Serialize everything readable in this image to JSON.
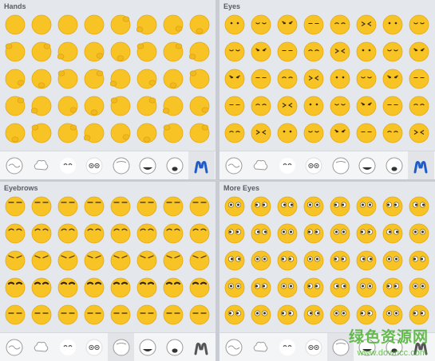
{
  "panels": [
    {
      "title": "Hands",
      "kind": "hands",
      "selected_tab": 7
    },
    {
      "title": "Eyes",
      "kind": "eyes",
      "selected_tab": 7
    },
    {
      "title": "Eyebrows",
      "kind": "brows",
      "selected_tab": 4
    },
    {
      "title": "More Eyes",
      "kind": "more",
      "selected_tab": 4
    }
  ],
  "tabs": [
    "outline-tab",
    "cloud-tab",
    "smile-eyes-tab",
    "wide-eyes-tab",
    "blank-tab",
    "grin-tab",
    "open-mouth-tab",
    "hands-tab"
  ],
  "colors": {
    "face": "#f7c325",
    "face_edge": "#e5a915",
    "feature": "#3a2a10",
    "accent": "#1f5cc8",
    "watermark": "#4db033"
  },
  "watermark": {
    "main": "绿色资源网",
    "sub": "www.downcc.com"
  }
}
